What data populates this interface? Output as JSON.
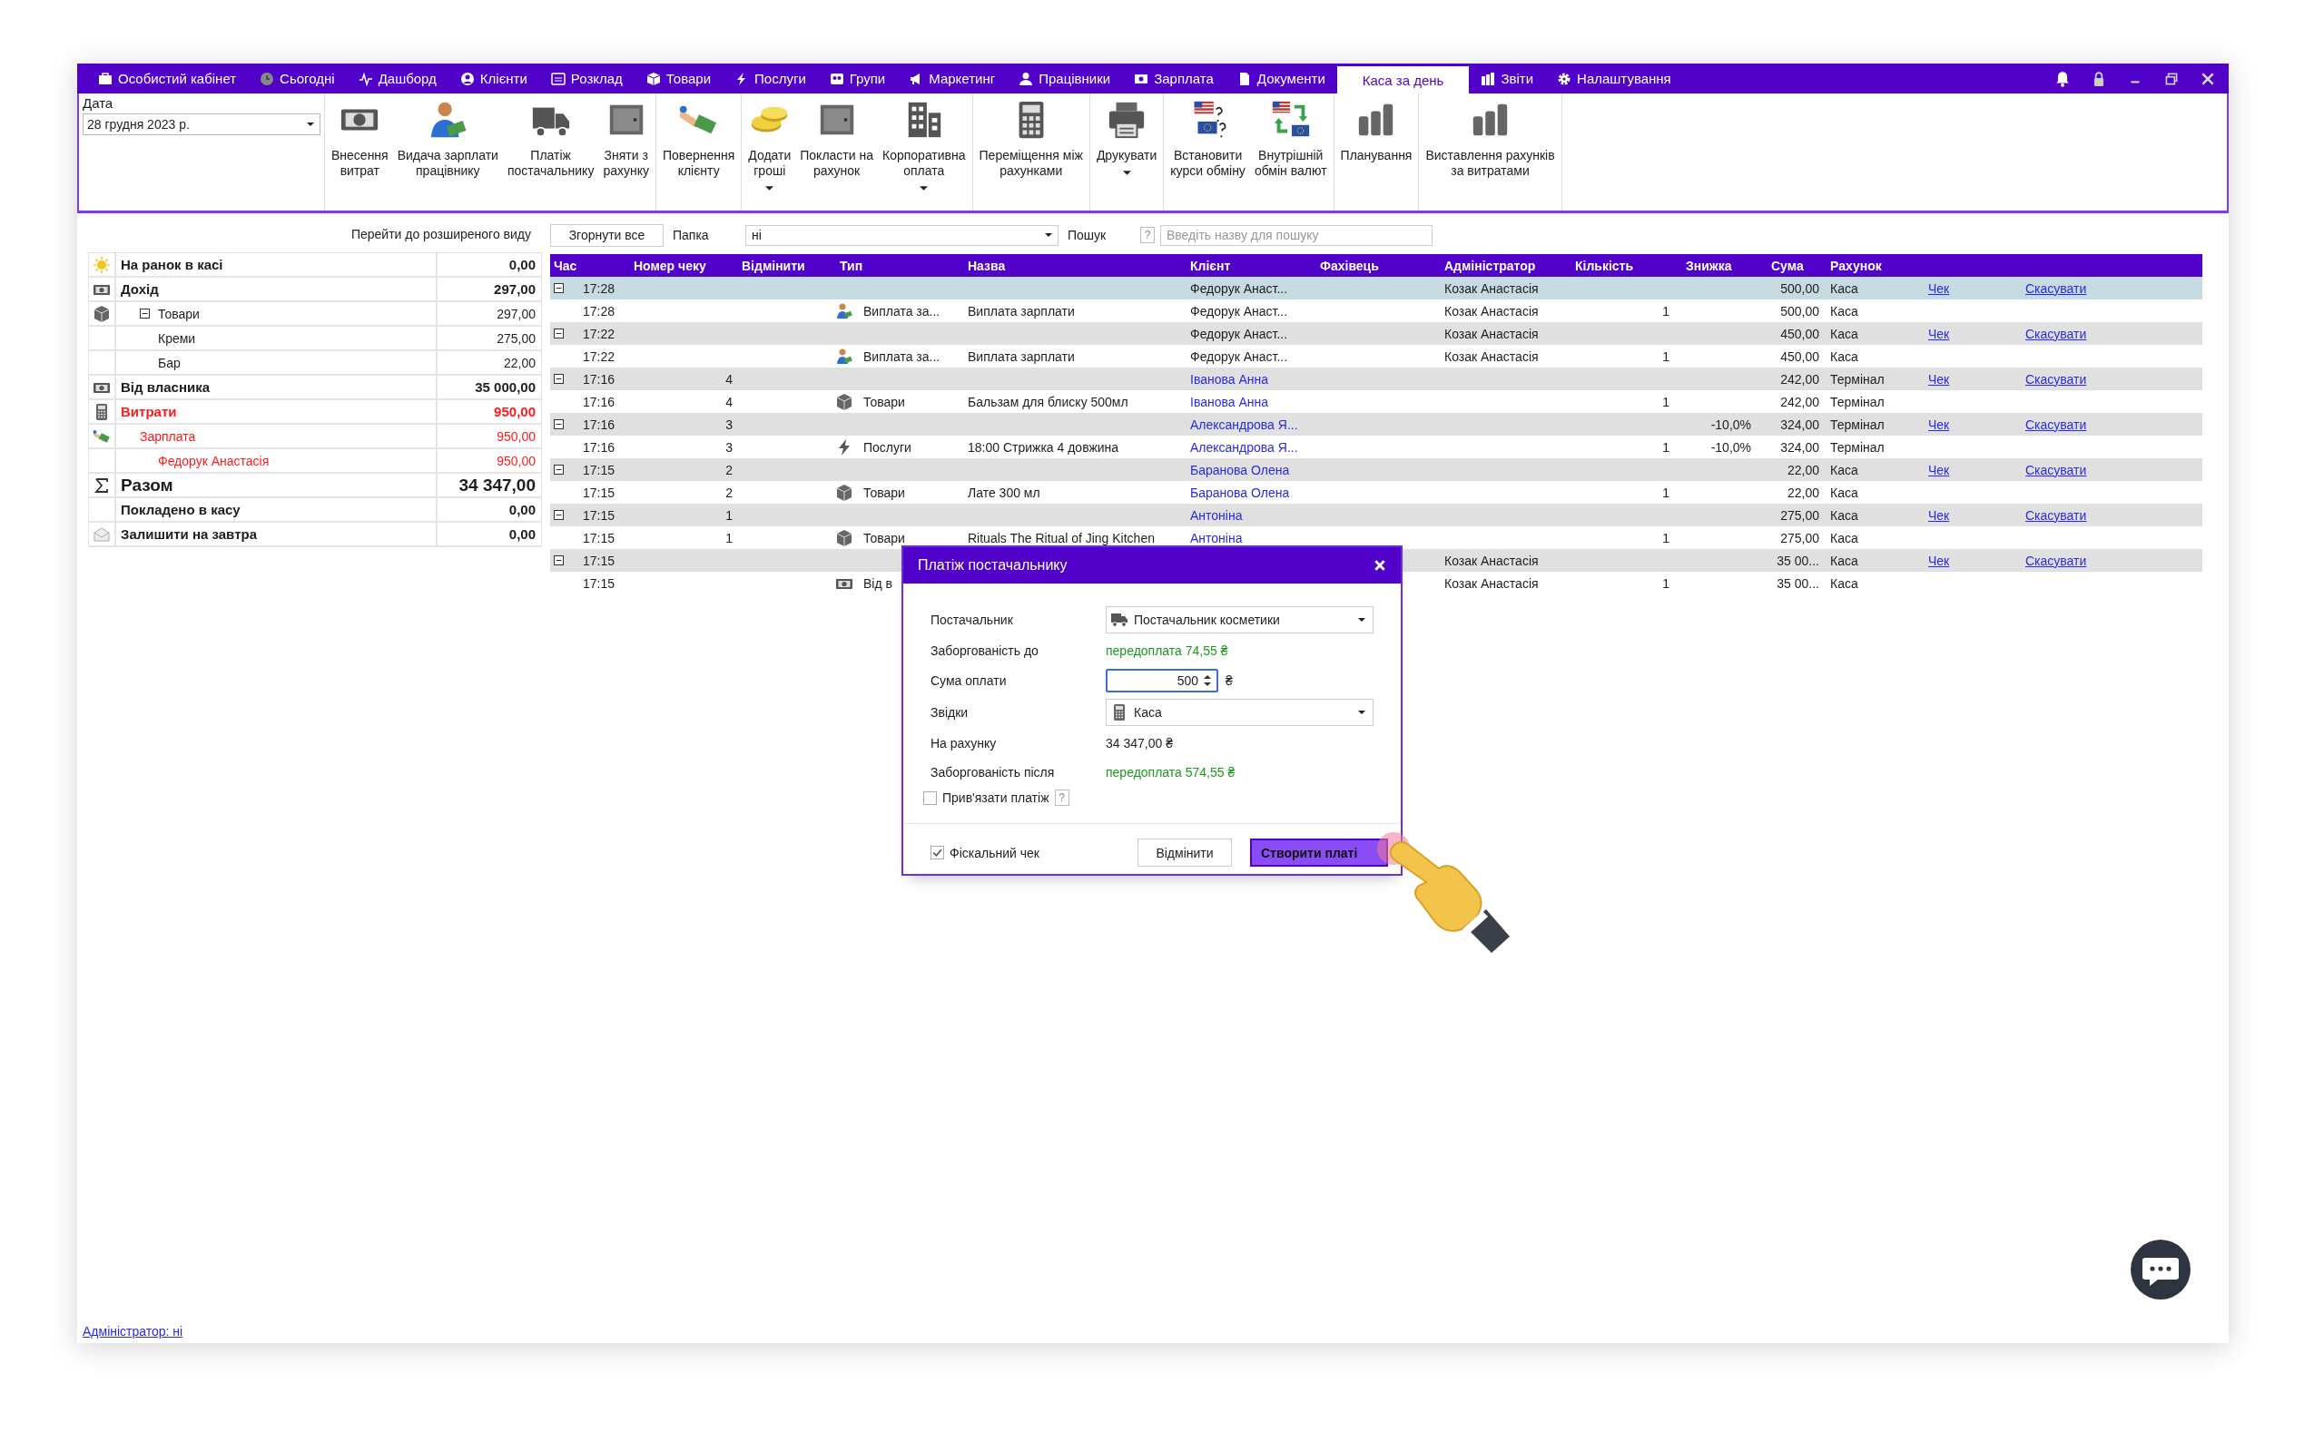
{
  "nav": [
    {
      "label": "Особистий кабінет",
      "selected": false
    },
    {
      "label": "Сьогодні",
      "selected": false
    },
    {
      "label": "Дашборд",
      "selected": false
    },
    {
      "label": "Клієнти",
      "selected": false
    },
    {
      "label": "Розклад",
      "selected": false
    },
    {
      "label": "Товари",
      "selected": false
    },
    {
      "label": "Послуги",
      "selected": false
    },
    {
      "label": "Групи",
      "selected": false
    },
    {
      "label": "Маркетинг",
      "selected": false
    },
    {
      "label": "Працівники",
      "selected": false
    },
    {
      "label": "Зарплата",
      "selected": false
    },
    {
      "label": "Документи",
      "selected": false
    },
    {
      "label": "Каса за день",
      "selected": true
    },
    {
      "label": "Звіти",
      "selected": false
    },
    {
      "label": "Налаштування",
      "selected": false
    }
  ],
  "toolbar": {
    "date_label": "Дата",
    "date_value": "28 грудня  2023 р.",
    "groups": [
      [
        {
          "label": "Внесення\nвитрат",
          "dropdown": false
        },
        {
          "label": "Видача зарплати\nпрацівнику",
          "dropdown": false
        },
        {
          "label": "Платіж\nпостачальнику",
          "dropdown": false
        },
        {
          "label": "Зняти з\nрахунку",
          "dropdown": false
        }
      ],
      [
        {
          "label": "Повернення\nклієнту",
          "dropdown": false
        }
      ],
      [
        {
          "label": "Додати\nгроші",
          "dropdown": true
        },
        {
          "label": "Покласти на\nрахунок",
          "dropdown": false
        },
        {
          "label": "Корпоративна\nоплата",
          "dropdown": true
        }
      ],
      [
        {
          "label": "Переміщення між\nрахунками",
          "dropdown": false
        }
      ],
      [
        {
          "label": "Друкувати",
          "dropdown": true
        }
      ],
      [
        {
          "label": "Встановити\nкурси обміну",
          "dropdown": false
        },
        {
          "label": "Внутрішній\nобмін валют",
          "dropdown": false
        }
      ],
      [
        {
          "label": "Планування",
          "dropdown": false
        }
      ],
      [
        {
          "label": "Виставлення рахунків\nза витратами",
          "dropdown": false
        }
      ]
    ]
  },
  "summary": {
    "link": "Перейти до розширеного виду",
    "items": [
      {
        "kind": "morning",
        "label": "На ранок в касі",
        "value": "0,00",
        "negative": false
      },
      {
        "kind": "income",
        "label": "Дохід",
        "value": "297,00",
        "negative": false,
        "children": [
          {
            "kind": "goods",
            "label": "Товари",
            "value": "297,00",
            "negative": false,
            "expanded": true,
            "children": [
              {
                "label": "Креми",
                "value": "275,00",
                "negative": false
              },
              {
                "label": "Бар",
                "value": "22,00",
                "negative": false
              }
            ]
          }
        ]
      },
      {
        "kind": "income",
        "label": "Від власника",
        "value": "35 000,00",
        "negative": false
      },
      {
        "kind": "expense",
        "label": "Витрати",
        "value": "950,00",
        "negative": true,
        "children": [
          {
            "kind": "salary",
            "label": "Зарплата",
            "value": "950,00",
            "negative": true,
            "children": [
              {
                "label": "Федорук Анастасія",
                "value": "950,00",
                "negative": true
              }
            ]
          }
        ]
      },
      {
        "kind": "total",
        "label": "Разом",
        "value": "34 347,00",
        "negative": false
      },
      {
        "label": "Покладено в касу",
        "value": "0,00",
        "negative": false
      },
      {
        "kind": "envelope",
        "label": "Залишити на завтра",
        "value": "0,00",
        "negative": false
      }
    ]
  },
  "table": {
    "collapse_button": "Згорнути все",
    "folder_label": "Папка",
    "folder_value": "ні",
    "search_label": "Пошук",
    "search_help": "?",
    "search_placeholder": "Введіть назву для пошуку",
    "columns": [
      "Час",
      "Номер чеку",
      "Відмінити",
      "Тип",
      "Назва",
      "Клієнт",
      "Фахівець",
      "Адміністратор",
      "Кількість",
      "Знижка",
      "Сума",
      "Рахунок"
    ],
    "rows": [
      {
        "kind": "group",
        "selected": true,
        "expanded": true,
        "time": "17:28",
        "client": "Федорук Анаст...",
        "client_link": false,
        "admin": "Козак Анастасія",
        "sum": "500,00",
        "account": "Каса",
        "check": "Чек",
        "cancel": "Скасувати"
      },
      {
        "kind": "salary",
        "selected": false,
        "time": "17:28",
        "type": "Виплата за...",
        "name": "Виплата зарплати",
        "client": "Федорук Анаст...",
        "client_link": false,
        "admin": "Козак Анастасія",
        "qty": "1",
        "sum": "500,00",
        "account": "Каса"
      },
      {
        "kind": "group",
        "selected": false,
        "expanded": true,
        "time": "17:22",
        "client": "Федорук Анаст...",
        "client_link": false,
        "admin": "Козак Анастасія",
        "sum": "450,00",
        "account": "Каса",
        "check": "Чек",
        "cancel": "Скасувати"
      },
      {
        "kind": "salary",
        "selected": false,
        "time": "17:22",
        "type": "Виплата за...",
        "name": "Виплата зарплати",
        "client": "Федорук Анаст...",
        "client_link": false,
        "admin": "Козак Анастасія",
        "qty": "1",
        "sum": "450,00",
        "account": "Каса"
      },
      {
        "kind": "group",
        "selected": false,
        "expanded": true,
        "time": "17:16",
        "number": "4",
        "client": "Іванова Анна",
        "client_link": true,
        "sum": "242,00",
        "account": "Термінал",
        "check": "Чек",
        "cancel": "Скасувати"
      },
      {
        "kind": "goods",
        "selected": false,
        "time": "17:16",
        "number": "4",
        "type": "Товари",
        "name": "Бальзам для блиску 500мл",
        "client": "Іванова Анна",
        "client_link": true,
        "qty": "1",
        "sum": "242,00",
        "account": "Термінал"
      },
      {
        "kind": "group",
        "selected": false,
        "expanded": true,
        "time": "17:16",
        "number": "3",
        "client": "Александрова Я...",
        "client_link": true,
        "discount": "-10,0%",
        "sum": "324,00",
        "account": "Термінал",
        "check": "Чек",
        "cancel": "Скасувати"
      },
      {
        "kind": "service",
        "selected": false,
        "time": "17:16",
        "number": "3",
        "type": "Послуги",
        "name": "18:00 Стрижка 4 довжина",
        "client": "Александрова Я...",
        "client_link": true,
        "qty": "1",
        "discount": "-10,0%",
        "sum": "324,00",
        "account": "Термінал"
      },
      {
        "kind": "group",
        "selected": false,
        "expanded": true,
        "time": "17:15",
        "number": "2",
        "client": "Баранова Олена",
        "client_link": true,
        "sum": "22,00",
        "account": "Каса",
        "check": "Чек",
        "cancel": "Скасувати"
      },
      {
        "kind": "goods",
        "selected": false,
        "time": "17:15",
        "number": "2",
        "type": "Товари",
        "name": "Лате 300 мл",
        "client": "Баранова Олена",
        "client_link": true,
        "qty": "1",
        "sum": "22,00",
        "account": "Каса"
      },
      {
        "kind": "group",
        "selected": false,
        "expanded": true,
        "time": "17:15",
        "number": "1",
        "client": "Антоніна",
        "client_link": true,
        "sum": "275,00",
        "account": "Каса",
        "check": "Чек",
        "cancel": "Скасувати"
      },
      {
        "kind": "goods",
        "selected": false,
        "time": "17:15",
        "number": "1",
        "type": "Товари",
        "name": "Rituals The Ritual of Jing Kitchen",
        "client": "Антоніна",
        "client_link": true,
        "qty": "1",
        "sum": "275,00",
        "account": "Каса"
      },
      {
        "kind": "group",
        "selected": false,
        "expanded": true,
        "time": "17:15",
        "admin": "Козак Анастасія",
        "sum": "35 00...",
        "account": "Каса",
        "check": "Чек",
        "cancel": "Скасувати"
      },
      {
        "kind": "income",
        "selected": false,
        "time": "17:15",
        "type": "Від в",
        "admin": "Козак Анастасія",
        "qty": "1",
        "sum": "35 00...",
        "account": "Каса"
      }
    ]
  },
  "dialog": {
    "title": "Платіж постачальнику",
    "fields": [
      {
        "kind": "select",
        "label": "Постачальник",
        "value": "Постачальник косметики"
      },
      {
        "kind": "text",
        "label": "Заборгованість до",
        "value": "передоплата 74,55 ₴",
        "positive": true
      },
      {
        "kind": "spin",
        "label": "Сума оплати",
        "value": "500",
        "unit": "₴"
      },
      {
        "kind": "select",
        "label": "Звідки",
        "value": "Каса"
      },
      {
        "kind": "text",
        "label": "На рахунку",
        "value": "34 347,00 ₴",
        "positive": false
      },
      {
        "kind": "text",
        "label": "Заборгованість після",
        "value": "передоплата 574,55 ₴",
        "positive": true
      }
    ],
    "bind": {
      "label": "Прив'язати платіж",
      "checked": false,
      "help": "?"
    },
    "fiscal": {
      "label": "Фіскальний чек",
      "checked": true
    },
    "buttons": [
      {
        "kind": "secondary",
        "label": "Відмінити"
      },
      {
        "kind": "primary",
        "label": "Створити платі"
      }
    ]
  },
  "footer_link": "Адміністратор: ні"
}
